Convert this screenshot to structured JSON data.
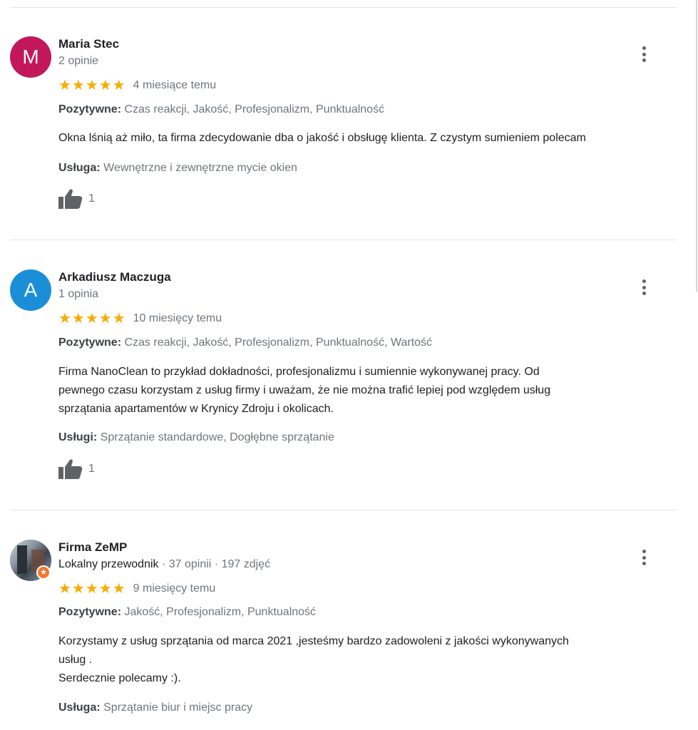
{
  "colors": {
    "star": "#f9ab00",
    "avatar_m": "#c2185b",
    "avatar_a": "#1a8fd8",
    "muted_text": "#70757a"
  },
  "reviews": [
    {
      "avatar_letter": "M",
      "name": "Maria Stec",
      "meta": "2 opinie",
      "rating": 5,
      "stars": "★★★★★",
      "date": "4 miesiące temu",
      "positive_label": "Pozytywne:",
      "positive_value": "Czas reakcji, Jakość, Profesjonalizm, Punktualność",
      "text_lines": [
        "Okna lśnią aż miło, ta firma zdecydowanie dba o jakość i obsługę klienta. Z czystym sumieniem polecam"
      ],
      "service_label": "Usługa:",
      "service_value": "Wewnętrzne i zewnętrzne mycie okien",
      "likes": "1"
    },
    {
      "avatar_letter": "A",
      "name": "Arkadiusz Maczuga",
      "meta": "1 opinia",
      "rating": 5,
      "stars": "★★★★★",
      "date": "10 miesięcy temu",
      "positive_label": "Pozytywne:",
      "positive_value": "Czas reakcji, Jakość, Profesjonalizm, Punktualność, Wartość",
      "text_lines": [
        "Firma NanoClean to przykład dokładności, profesjonalizmu i sumiennie wykonywanej pracy. Od",
        "pewnego czasu korzystam z usług firmy i uważam, że nie można trafić lepiej pod względem usług",
        "sprzątania apartamentów w Krynicy Zdroju i okolicach."
      ],
      "service_label": "Usługi:",
      "service_value": "Sprzątanie standardowe, Dogłębne sprzątanie",
      "likes": "1"
    },
    {
      "name": "Firma ZeMP",
      "meta_guide": "Lokalny przewodnik",
      "meta_rest": " · 37 opinii · 197 zdjęć",
      "rating": 5,
      "stars": "★★★★★",
      "date": "9 miesięcy temu",
      "positive_label": "Pozytywne:",
      "positive_value": "Jakość, Profesjonalizm, Punktualność",
      "text_lines": [
        "Korzystamy z usług sprzątania od marca 2021 ,jesteśmy bardzo  zadowoleni z jakości wykonywanych",
        "usług .",
        "Serdecznie polecamy :)."
      ],
      "service_label": "Usługa:",
      "service_value": "Sprzątanie biur i miejsc pracy",
      "guide_badge_icon": "star-badge-icon"
    }
  ]
}
